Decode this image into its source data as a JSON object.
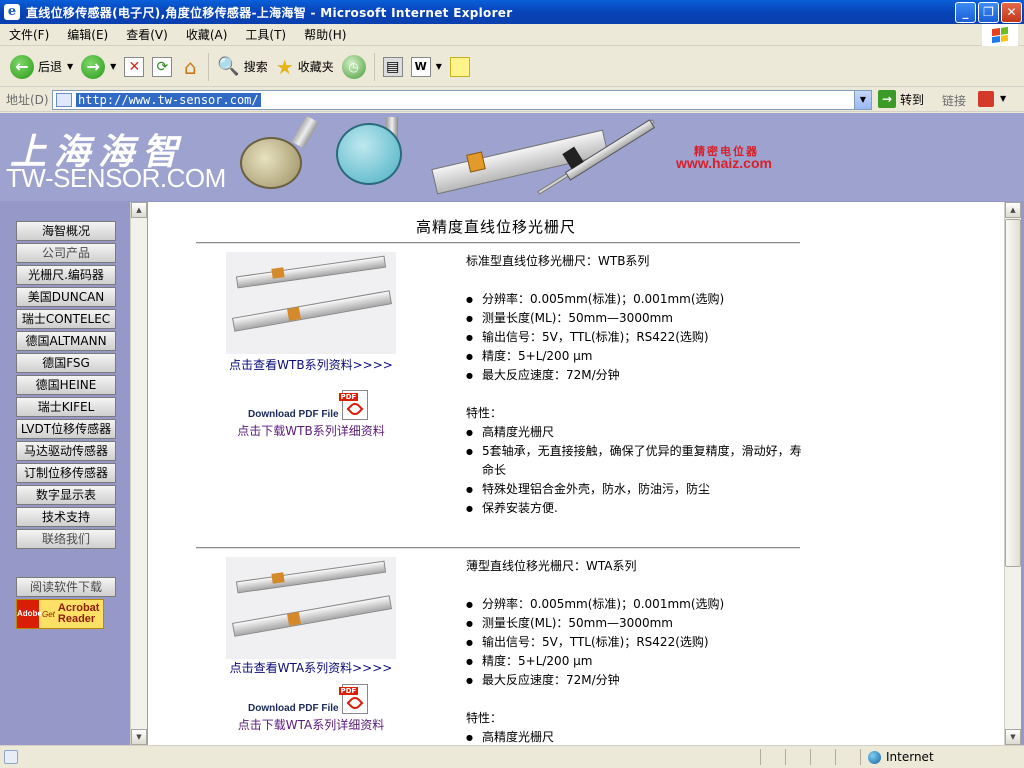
{
  "window": {
    "title": "直线位移传感器(电子尺),角度位移传感器-上海海智 - Microsoft Internet Explorer",
    "icon": "ie-icon",
    "minimize": "_",
    "maximize": "❐",
    "close": "✕"
  },
  "menu": [
    "文件(F)",
    "编辑(E)",
    "查看(V)",
    "收藏(A)",
    "工具(T)",
    "帮助(H)"
  ],
  "toolbar": {
    "back": "后退",
    "search": "搜索",
    "favorites": "收藏夹"
  },
  "address": {
    "label": "地址(D)",
    "url": "http://www.tw-sensor.com/",
    "go": "转到",
    "links": "链接"
  },
  "banner": {
    "logo_cn": "上海海智",
    "logo_en": "TW-SENSOR.COM",
    "tag_text": "精密电位器",
    "site_url": "www.haiz.com"
  },
  "nav": {
    "items": [
      "海智概况",
      "公司产品",
      "光栅尺.编码器",
      "美国DUNCAN",
      "瑞士CONTELEC",
      "德国ALTMANN",
      "德国FSG",
      "德国HEINE",
      "瑞士KIFEL",
      "LVDT位移传感器",
      "马达驱动传感器",
      "订制位移传感器",
      "数字显示表",
      "技术支持",
      "联络我们"
    ],
    "reader_download": "阅读软件下载",
    "acrobat": {
      "get": "Get",
      "adobe": "Adobe",
      "line1": "Acrobat",
      "line2": "Reader"
    }
  },
  "content": {
    "heading": "高精度直线位移光栅尺",
    "products": [
      {
        "title": "标准型直线位移光栅尺：WTB系列",
        "view_link": "点击查看WTB系列资料>>>>",
        "pdf_label": "Download PDF File",
        "pdf_tag": "PDF",
        "download_link": "点击下载WTB系列详细资料",
        "specs": [
          "分辨率：0.005mm(标准)；0.001mm(选购)",
          "测量长度(ML)：50mm—3000mm",
          "输出信号：5V，TTL(标准)；RS422(选购)",
          "精度：5+L/200 μm",
          "最大反应速度：72M/分钟"
        ],
        "feature_label": "特性：",
        "features": [
          "高精度光栅尺",
          "5套轴承，无直接接触，确保了优异的重复精度，滑动好，寿命长",
          "特殊处理铝合金外壳，防水，防油污，防尘",
          "保养安装方便."
        ]
      },
      {
        "title": "薄型直线位移光栅尺：WTA系列",
        "view_link": "点击查看WTA系列资料>>>>",
        "pdf_label": "Download PDF File",
        "pdf_tag": "PDF",
        "download_link": "点击下载WTA系列详细资料",
        "specs": [
          "分辨率：0.005mm(标准)；0.001mm(选购)",
          "测量长度(ML)：50mm—3000mm",
          "输出信号：5V，TTL(标准)；RS422(选购)",
          "精度：5+L/200 μm",
          "最大反应速度：72M/分钟"
        ],
        "feature_label": "特性：",
        "features": [
          "高精度光栅尺"
        ]
      }
    ]
  },
  "status": {
    "zone": "Internet"
  }
}
